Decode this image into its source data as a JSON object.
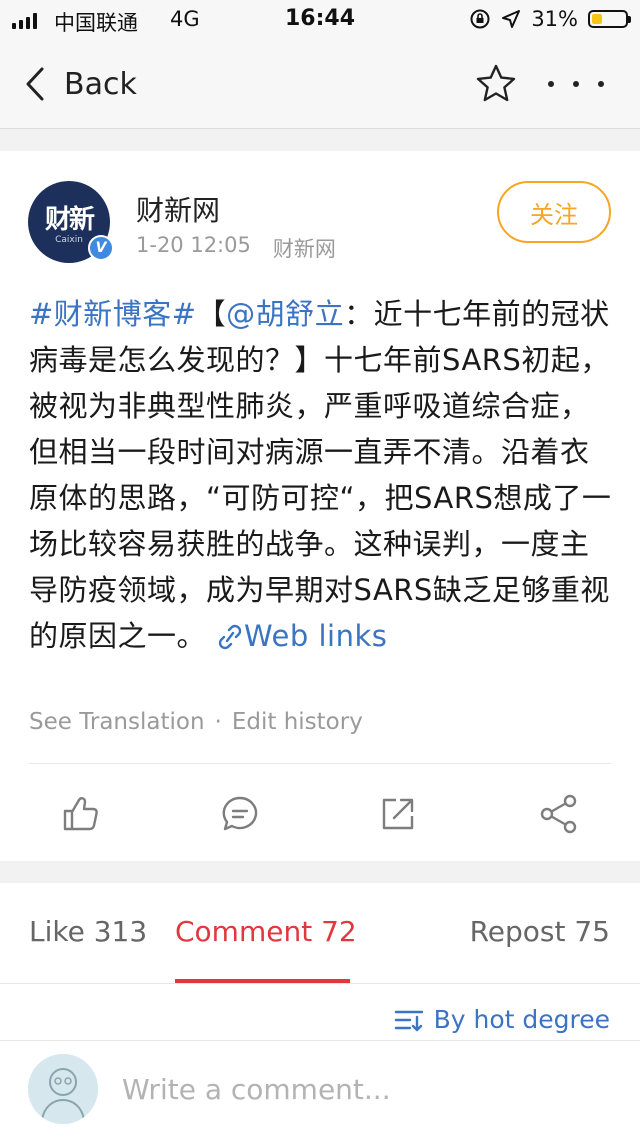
{
  "status_bar": {
    "carrier": "中国联通",
    "network": "4G",
    "time": "16:44",
    "battery_percent": "31%",
    "battery_level": 0.31,
    "icons": [
      "signal-bars-icon",
      "orientation-lock-icon",
      "location-arrow-icon",
      "battery-icon"
    ]
  },
  "nav": {
    "back_label": "Back",
    "icons": [
      "chevron-left-icon",
      "star-icon",
      "more-icon"
    ]
  },
  "post": {
    "author": "财新网",
    "avatar_text_cn": "财新",
    "avatar_text_en": "Caixin",
    "verified_badge": "V",
    "timestamp": "1-20 12:05",
    "source": "财新网",
    "follow_label": "关注",
    "body": {
      "hashtag": "#财新博客#",
      "bracket_open": "【",
      "mention": "@胡舒立",
      "text": "：近十七年前的冠状病毒是怎么发现的？】十七年前SARS初起，被视为非典型性肺炎，严重呼吸道综合症，但相当一段时间对病源一直弄不清。沿着衣原体的思路，“可防可控“，把SARS想成了一场比较容易获胜的战争。这种误判，一度主导防疫领域，成为早期对SARS缺乏足够重视的原因之一。",
      "web_link": "Web links"
    },
    "see_translation": "See Translation",
    "separator": "·",
    "edit_history": "Edit history",
    "action_icons": [
      "thumbs-up-icon",
      "comment-icon",
      "repost-icon",
      "share-icon"
    ]
  },
  "tabs": {
    "like": "Like 313",
    "comment": "Comment 72",
    "repost": "Repost 75",
    "active": "comment"
  },
  "sort": {
    "label": "By hot degree",
    "icon": "sort-icon"
  },
  "comment_bar": {
    "placeholder": "Write a comment..."
  },
  "colors": {
    "accent_red": "#e0383e",
    "link_blue": "#3a74c2",
    "follow_orange": "#f6a623",
    "verified_blue": "#3f8ae0",
    "battery_yellow": "#f5c518"
  }
}
